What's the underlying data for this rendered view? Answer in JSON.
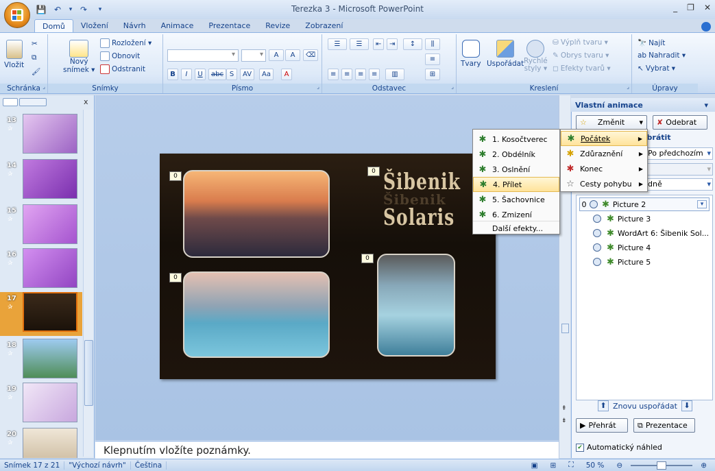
{
  "window": {
    "title": "Terezka 3 - Microsoft PowerPoint",
    "minimize": "_",
    "restore": "❐",
    "close": "✕"
  },
  "qat": {
    "save": "💾",
    "undo": "↶",
    "undo_drop": "▾",
    "redo": "↷",
    "more": "▾"
  },
  "tabs": [
    "Domů",
    "Vložení",
    "Návrh",
    "Animace",
    "Prezentace",
    "Revize",
    "Zobrazení"
  ],
  "ribbon": {
    "clipboard": {
      "label": "Schránka",
      "paste": "Vložit"
    },
    "slides": {
      "label": "Snímky",
      "new_slide": "Nový",
      "new_slide2": "snímek ▾",
      "layout": "Rozložení ▾",
      "reset": "Obnovit",
      "delete": "Odstranit"
    },
    "font": {
      "label": "Písmo",
      "bold": "B",
      "italic": "I",
      "underline": "U",
      "strike": "abc",
      "shadow": "S",
      "spacing": "AV",
      "case": "Aa",
      "color": "A",
      "grow": "A",
      "shrink": "A"
    },
    "paragraph": {
      "label": "Odstavec"
    },
    "drawing": {
      "label": "Kreslení",
      "shapes": "Tvary",
      "arrange": "Uspořádat",
      "quick_styles": "Rychlé",
      "quick_styles2": "styly ▾",
      "fill": "Výplň tvaru ▾",
      "outline": "Obrys tvaru ▾",
      "effects": "Efekty tvarů ▾"
    },
    "editing": {
      "label": "Úpravy",
      "find": "Najít",
      "replace": "Nahradit ▾",
      "select": "Vybrat ▾"
    }
  },
  "slides_panel": {
    "close": "x",
    "thumbs": [
      {
        "num": "13",
        "color": "#b88fd0"
      },
      {
        "num": "14",
        "color": "#a05bc9"
      },
      {
        "num": "15",
        "color": "#c07de0"
      },
      {
        "num": "16",
        "color": "#b46bd8"
      },
      {
        "num": "17",
        "color": "#2a1d12"
      },
      {
        "num": "18",
        "color": "#6ab0d8"
      },
      {
        "num": "19",
        "color": "#d8c6e6"
      },
      {
        "num": "20",
        "color": "#e6dccc"
      }
    ]
  },
  "slide": {
    "badges": [
      "0",
      "0",
      "0",
      "0"
    ],
    "wordart_line1": "Šibenik",
    "wordart_line2": "Šibenik",
    "wordart_line3": "Solaris"
  },
  "notes": {
    "placeholder": "Klepnutím vložíte poznámky."
  },
  "task_pane": {
    "title": "Vlastní animace",
    "change": "Změnit",
    "remove": "Odebrat",
    "modify": "obrátit",
    "start_value": "Po předchozím",
    "speed_value": "dně",
    "items": [
      {
        "order": "0",
        "name": "Picture 2"
      },
      {
        "order": "",
        "name": "Picture 3"
      },
      {
        "order": "",
        "name": "WordArt 6: Šibenik Sol..."
      },
      {
        "order": "",
        "name": "Picture 4"
      },
      {
        "order": "",
        "name": "Picture 5"
      }
    ],
    "reorder": "Znovu uspořádat",
    "play": "Přehrát",
    "slideshow": "Prezentace",
    "autopreview": "Automatický náhled"
  },
  "menu_main": {
    "items": [
      {
        "label": "Počátek",
        "accel": "P"
      },
      {
        "label": "Zdůraznění",
        "accel": "Z"
      },
      {
        "label": "Konec",
        "accel": "K"
      },
      {
        "label": "Cesty pohybu",
        "accel": "C"
      }
    ]
  },
  "menu_sub": {
    "items": [
      {
        "label": "1. Kosočtverec"
      },
      {
        "label": "2. Obdélník"
      },
      {
        "label": "3. Oslnění"
      },
      {
        "label": "4. Přílet"
      },
      {
        "label": "5. Šachovnice"
      },
      {
        "label": "6. Zmizení"
      },
      {
        "label": "Další efekty..."
      }
    ]
  },
  "status": {
    "slide": "Snímek 17 z 21",
    "theme": "\"Výchozí návrh\"",
    "language": "Čeština",
    "zoom": "50 %"
  }
}
